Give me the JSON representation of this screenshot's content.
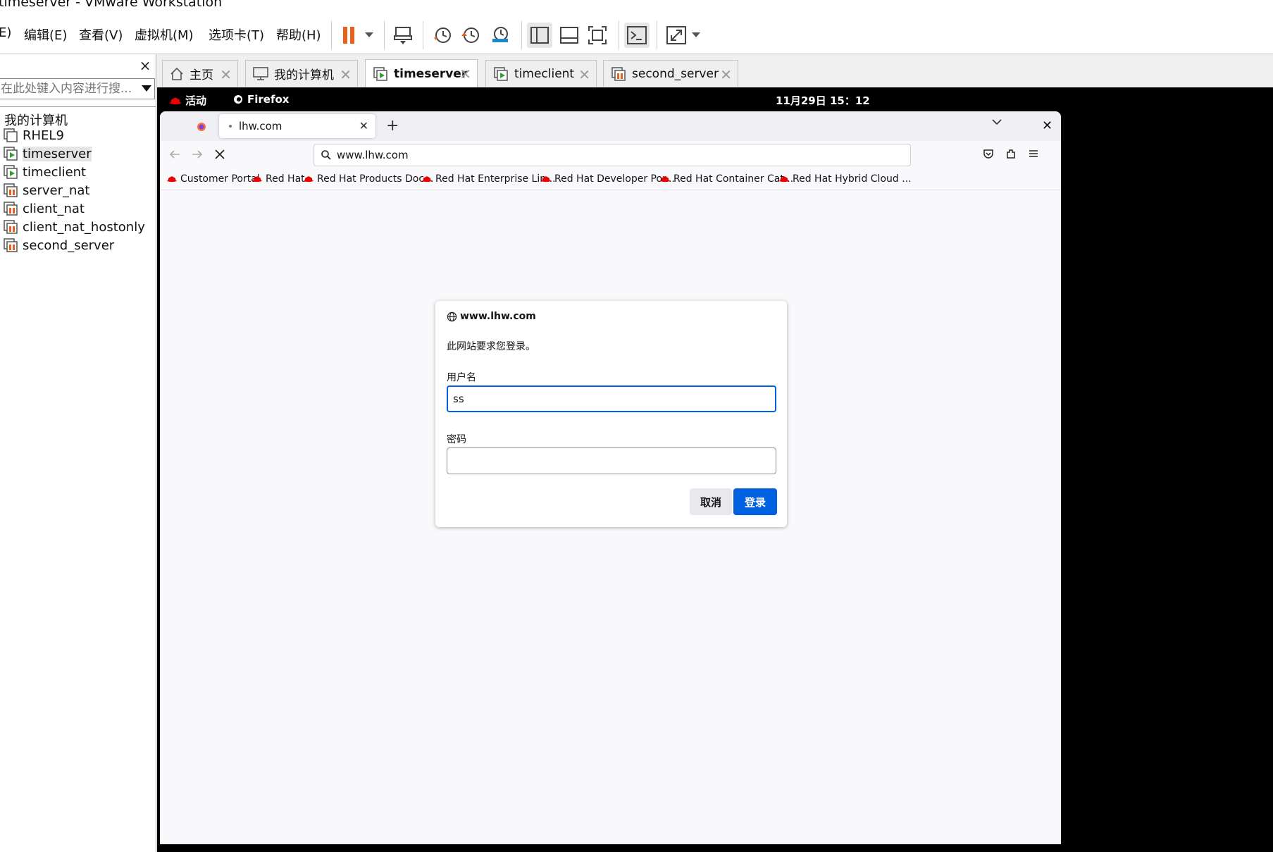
{
  "window": {
    "title": "timeserver - VMware Workstation"
  },
  "menubar": {
    "items": [
      {
        "label": "E)"
      },
      {
        "label": "编辑(E)"
      },
      {
        "label": "查看(V)"
      },
      {
        "label": "虚拟机(M)"
      },
      {
        "label": "选项卡(T)"
      },
      {
        "label": "帮助(H)"
      }
    ],
    "toolbar_icons": [
      "pause-icon",
      "dropdown-icon",
      "send-ctrl-alt-del-icon",
      "snapshot-icon",
      "revert-snapshot-icon",
      "snapshot-manager-icon",
      "show-library-icon",
      "thumbnail-bar-icon",
      "full-screen-icon",
      "console-view-icon",
      "stretch-guest-icon",
      "dropdown-icon"
    ]
  },
  "sidebar": {
    "close_label": "×",
    "search_placeholder": "在此处键入内容进行搜...",
    "root": "我的计算机",
    "items": [
      {
        "label": "RHEL9",
        "state": "off"
      },
      {
        "label": "timeserver",
        "state": "running"
      },
      {
        "label": "timeclient",
        "state": "running"
      },
      {
        "label": "server_nat",
        "state": "suspended"
      },
      {
        "label": "client_nat",
        "state": "suspended"
      },
      {
        "label": "client_nat_hostonly",
        "state": "suspended"
      },
      {
        "label": "second_server",
        "state": "suspended"
      }
    ]
  },
  "vm_tabs": [
    {
      "label": "主页",
      "icon": "home-icon"
    },
    {
      "label": "我的计算机",
      "icon": "computer-icon"
    },
    {
      "label": "timeserver",
      "icon": "vm-running-icon",
      "active": true
    },
    {
      "label": "timeclient",
      "icon": "vm-running-icon"
    },
    {
      "label": "second_server",
      "icon": "vm-suspended-icon"
    }
  ],
  "guest": {
    "activities": "活动",
    "app_name": "Firefox",
    "clock": "11月29日  15：12"
  },
  "firefox": {
    "tab_title": "lhw.com",
    "url": "www.lhw.com",
    "bookmarks": [
      "Customer Portal",
      "Red Hat",
      "Red Hat Products Doc...",
      "Red Hat Enterprise Lin...",
      "Red Hat Developer Por...",
      "Red Hat Container Cat...",
      "Red Hat Hybrid Cloud ..."
    ]
  },
  "auth_dialog": {
    "host": "www.lhw.com",
    "message": "此网站要求您登录。",
    "username_label": "用户名",
    "username_value": "ss",
    "password_label": "密码",
    "cancel_label": "取消",
    "login_label": "登录",
    "accent": "#0061e0"
  }
}
